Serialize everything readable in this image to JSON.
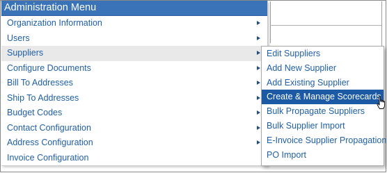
{
  "menu": {
    "title": "Administration Menu",
    "items": [
      {
        "label": "Organization Information",
        "has_submenu": true
      },
      {
        "label": "Users",
        "has_submenu": true
      },
      {
        "label": "Suppliers",
        "has_submenu": true,
        "active": true
      },
      {
        "label": "Configure Documents",
        "has_submenu": true
      },
      {
        "label": "Bill To Addresses",
        "has_submenu": true
      },
      {
        "label": "Ship To Addresses",
        "has_submenu": true
      },
      {
        "label": "Budget Codes",
        "has_submenu": true
      },
      {
        "label": "Contact Configuration",
        "has_submenu": true
      },
      {
        "label": "Address Configuration",
        "has_submenu": true
      },
      {
        "label": "Invoice Configuration",
        "has_submenu": false
      }
    ]
  },
  "submenu": {
    "items": [
      {
        "label": "Edit Suppliers"
      },
      {
        "label": "Add New Supplier"
      },
      {
        "label": "Add Existing Supplier"
      },
      {
        "label": "Create & Manage Scorecards",
        "highlighted": true
      },
      {
        "label": "Bulk Propagate Suppliers"
      },
      {
        "label": "Bulk Supplier Import"
      },
      {
        "label": "E-Invoice Supplier Propagation"
      },
      {
        "label": "PO Import"
      }
    ]
  },
  "colors": {
    "header_bg": "#3b73b9",
    "link_text": "#1f5fa8",
    "highlight_bg": "#1c5aa6",
    "active_bg": "#e9e9e9"
  },
  "icons": {
    "submenu_arrow": "triangle-right-icon",
    "cursor": "hand-pointer-icon"
  }
}
